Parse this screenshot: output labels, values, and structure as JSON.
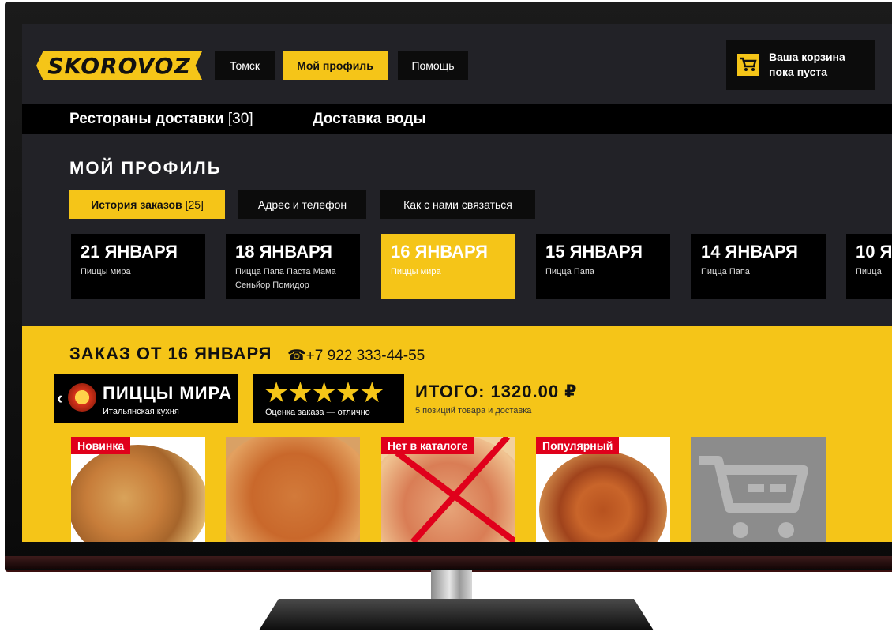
{
  "header": {
    "logo": "SKOROVOZ",
    "nav": [
      "Томск",
      "Мой профиль",
      "Помощь"
    ],
    "cart_line1": "Ваша корзина",
    "cart_line2": "пока пуста"
  },
  "categories": {
    "restaurants_label": "Рестораны доставки",
    "restaurants_count": "[30]",
    "water_label": "Доставка воды"
  },
  "profile": {
    "title": "МОЙ ПРОФИЛЬ",
    "tabs": [
      {
        "label": "История заказов",
        "count": "[25]"
      },
      {
        "label": "Адрес и телефон",
        "count": ""
      },
      {
        "label": "Как с нами связаться",
        "count": ""
      }
    ]
  },
  "orders": [
    {
      "date": "21 ЯНВАРЯ",
      "restaurant": "Пиццы мира"
    },
    {
      "date": "18 ЯНВАРЯ",
      "restaurant": "Пицца Папа Паста Мама Сеньйор Помидор"
    },
    {
      "date": "16 ЯНВАРЯ",
      "restaurant": "Пиццы мира"
    },
    {
      "date": "15 ЯНВАРЯ",
      "restaurant": "Пицца Папа"
    },
    {
      "date": "14 ЯНВАРЯ",
      "restaurant": "Пицца Папа"
    },
    {
      "date": "10 Я",
      "restaurant": "Пицца"
    }
  ],
  "selected_order_index": 2,
  "order_detail": {
    "title": "ЗАКАЗ ОТ 16 ЯНВАРЯ",
    "phone_icon": "telephone-icon",
    "phone": "+7 922 333-44-55",
    "restaurant_name": "ПИЦЦЫ МИРА",
    "restaurant_cuisine": "Итальянская кухня",
    "rating_stars": 5,
    "rating_text": "Оценка заказа — отлично",
    "total": "ИТОГО: 1320.00 ₽",
    "total_sub": "5 позиций товара и доставка"
  },
  "items": [
    {
      "badge": "Новинка"
    },
    {
      "badge": ""
    },
    {
      "badge": "Нет в каталоге",
      "unavailable": true
    },
    {
      "badge": "Популярный"
    },
    {
      "badge": "",
      "type": "cart"
    }
  ],
  "colors": {
    "accent": "#f5c518",
    "screen_bg": "#222227",
    "badge_red": "#e0001b"
  }
}
